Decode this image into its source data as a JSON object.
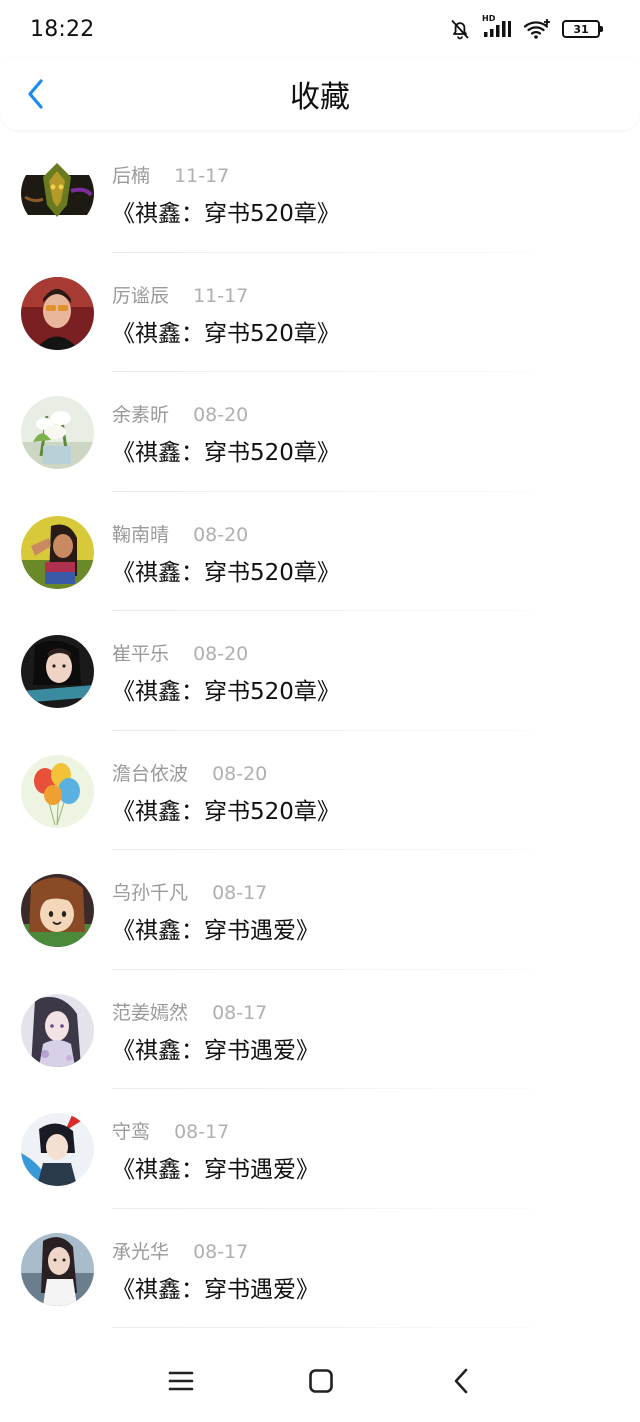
{
  "status_bar": {
    "time": "18:22",
    "network_badge": "HD",
    "battery_level": "31",
    "icons": [
      "mute-bell-icon",
      "signal-icon",
      "wifi-icon",
      "battery-icon"
    ]
  },
  "header": {
    "title": "收藏",
    "back_icon": "chevron-left-icon",
    "accent_color": "#1a8cf0"
  },
  "favorites": [
    {
      "name": "后楠",
      "date": "11-17",
      "title": "《祺鑫：穿书520章》"
    },
    {
      "name": "厉谧辰",
      "date": "11-17",
      "title": "《祺鑫：穿书520章》"
    },
    {
      "name": "余素昕",
      "date": "08-20",
      "title": "《祺鑫：穿书520章》"
    },
    {
      "name": "鞠南晴",
      "date": "08-20",
      "title": "《祺鑫：穿书520章》"
    },
    {
      "name": "崔平乐",
      "date": "08-20",
      "title": "《祺鑫：穿书520章》"
    },
    {
      "name": "澹台依波",
      "date": "08-20",
      "title": "《祺鑫：穿书520章》"
    },
    {
      "name": "乌孙千凡",
      "date": "08-17",
      "title": "《祺鑫：穿书遇爱》"
    },
    {
      "name": "范姜嫣然",
      "date": "08-17",
      "title": "《祺鑫：穿书遇爱》"
    },
    {
      "name": "守鸾",
      "date": "08-17",
      "title": "《祺鑫：穿书遇爱》"
    },
    {
      "name": "承光华",
      "date": "08-17",
      "title": "《祺鑫：穿书遇爱》"
    }
  ],
  "nav_bar": {
    "icons": [
      "menu-icon",
      "home-icon",
      "back-icon"
    ]
  }
}
